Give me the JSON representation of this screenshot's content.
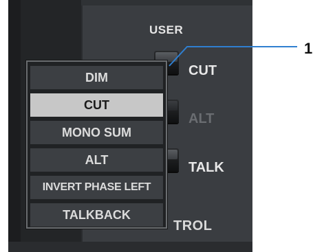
{
  "section": {
    "title": "USER"
  },
  "buttons": {
    "cut_label": "CUT",
    "alt_label": "ALT",
    "talk_label": "TALK"
  },
  "bottom_label_partial": "TROL",
  "menu": {
    "items": [
      {
        "label": "DIM",
        "selected": false
      },
      {
        "label": "CUT",
        "selected": true
      },
      {
        "label": "MONO SUM",
        "selected": false
      },
      {
        "label": "ALT",
        "selected": false
      },
      {
        "label": "INVERT PHASE LEFT",
        "selected": false
      },
      {
        "label": "TALKBACK",
        "selected": false
      }
    ]
  },
  "callout": {
    "number": "1",
    "color": "#2f7fd0"
  },
  "colors": {
    "panel_bg": "#3a3d41",
    "menu_item_bg": "#3c3f43",
    "menu_selected_bg": "#c7c7c7"
  }
}
